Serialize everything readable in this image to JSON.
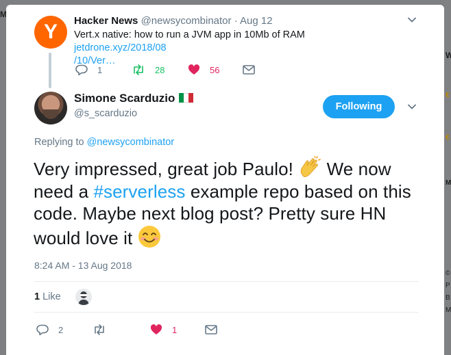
{
  "background": {
    "left_fragment": "Me",
    "right_letters": [
      "W",
      "€",
      "€",
      "M",
      "©",
      "P",
      "B",
      "M"
    ]
  },
  "parent_tweet": {
    "avatar_letter": "Y",
    "avatar_color": "#ff6600",
    "author_name": "Hacker News",
    "author_handle": "@newsycombinator",
    "separator": "·",
    "date": "Aug 12",
    "text": "Vert.x native: how to run a JVM app in 10Mb of RAM ",
    "link_text_line1": "jetdrone.xyz/2018/08",
    "link_text_line2": "/10/Ver…",
    "reply_count": "1",
    "retweet_count": "28",
    "like_count": "56"
  },
  "main_tweet": {
    "author_name": "Simone Scarduzio",
    "author_handle": "@s_scarduzio",
    "follow_label": "Following",
    "replying_label": "Replying to ",
    "replying_handle": "@newsycombinator",
    "text_part1": "Very impressed, great job Paulo! ",
    "text_part2": " We now need  a ",
    "hashtag": "#serverless",
    "text_part3": " example repo based on this code. Maybe next blog post? Pretty sure HN would love it ",
    "timestamp": "8:24 AM - 13 Aug 2018",
    "likes_count": "1",
    "likes_label": " Like",
    "reply_count": "2",
    "retweet_count": "",
    "like_count": "1"
  },
  "colors": {
    "accent": "#1da1f2",
    "muted": "#657786",
    "retweet_green": "#17bf63",
    "like_red": "#e0245e",
    "flag_green": "#009246",
    "flag_white": "#ffffff",
    "flag_red": "#ce2b37"
  },
  "icons": [
    "reply-icon",
    "retweet-icon",
    "heart-icon",
    "mail-icon",
    "chevron-down-icon",
    "clapping-hands-emoji",
    "smiling-face-emoji",
    "italy-flag-icon"
  ]
}
